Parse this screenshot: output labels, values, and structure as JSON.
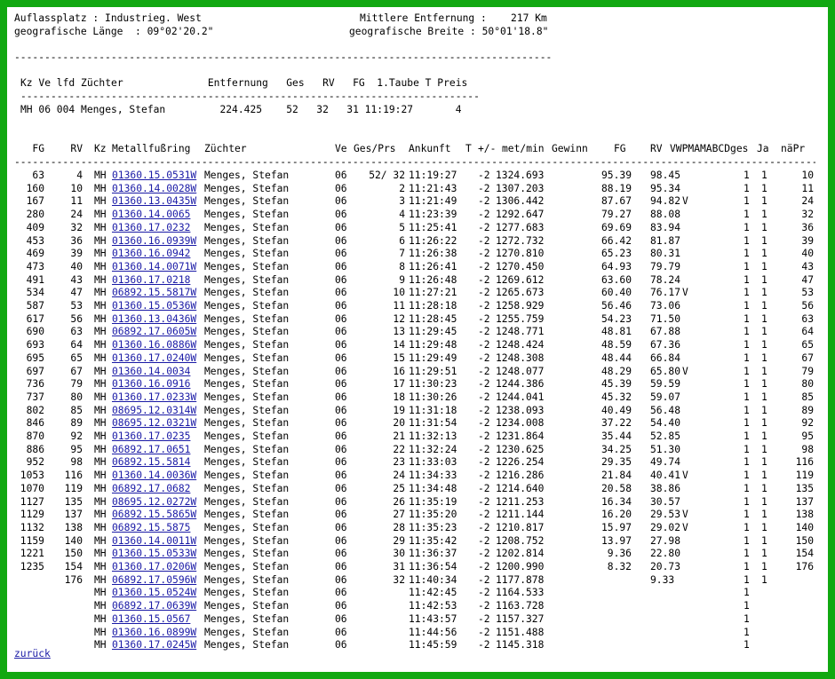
{
  "header": {
    "left1": "Auflassplatz : Industrieg. West",
    "right1": "Mittlere Entfernung :    217 Km",
    "left2": "geografische Länge  : 09°02'20.2\"",
    "right2": "geografische Breite : 50°01'18.8\"",
    "rule_long": "--------------------------------------------------------------------------------------------------------"
  },
  "summary": {
    "headers": "Kz Ve lfd Züchter              Entfernung   Ges   RV   FG  1.Taube T Preis",
    "rule": "--------------------------------------------------------------------------------------------",
    "row": "MH 06 004 Menges, Stefan         224.425    52   32   31 11:19:27       4"
  },
  "table": {
    "columns": {
      "fg": "FG",
      "rv": "RV",
      "kz": "Kz",
      "ring": "Metallfußring",
      "name": "Züchter",
      "ve": "Ve",
      "gespr": "Ges/Prs",
      "ankunft": "Ankunft",
      "t": "T",
      "pm": "+/-",
      "speed": "met/min",
      "gewinn": "Gewinn",
      "fg2": "FG",
      "rv2": "RV",
      "flags": "VWPMAMABCDges",
      "ja": "Ja",
      "napr": "näPr"
    },
    "rule": "----------------------------------------------------------------------------------------------------------------------------------------------------------",
    "rows": [
      {
        "fg": "63",
        "rv": "4",
        "kz": "MH",
        "ring": "01360.15.0531W",
        "name": "Menges, Stefan",
        "ve": "06",
        "pos": "52/ 32",
        "ankunft": "11:19:27",
        "pm": "-2",
        "speed": "1324.693",
        "fg2": "95.39",
        "rv2": "98.45",
        "v": "",
        "c1": "1",
        "c2": "1",
        "napr": "10"
      },
      {
        "fg": "160",
        "rv": "10",
        "kz": "MH",
        "ring": "01360.14.0028W",
        "name": "Menges, Stefan",
        "ve": "06",
        "pos": "2",
        "ankunft": "11:21:43",
        "pm": "-2",
        "speed": "1307.203",
        "fg2": "88.19",
        "rv2": "95.34",
        "v": "",
        "c1": "1",
        "c2": "1",
        "napr": "11"
      },
      {
        "fg": "167",
        "rv": "11",
        "kz": "MH",
        "ring": "01360.13.0435W",
        "name": "Menges, Stefan",
        "ve": "06",
        "pos": "3",
        "ankunft": "11:21:49",
        "pm": "-2",
        "speed": "1306.442",
        "fg2": "87.67",
        "rv2": "94.82",
        "v": "V",
        "c1": "1",
        "c2": "1",
        "napr": "24"
      },
      {
        "fg": "280",
        "rv": "24",
        "kz": "MH",
        "ring": "01360.14.0065",
        "name": "Menges, Stefan",
        "ve": "06",
        "pos": "4",
        "ankunft": "11:23:39",
        "pm": "-2",
        "speed": "1292.647",
        "fg2": "79.27",
        "rv2": "88.08",
        "v": "",
        "c1": "1",
        "c2": "1",
        "napr": "32"
      },
      {
        "fg": "409",
        "rv": "32",
        "kz": "MH",
        "ring": "01360.17.0232",
        "name": "Menges, Stefan",
        "ve": "06",
        "pos": "5",
        "ankunft": "11:25:41",
        "pm": "-2",
        "speed": "1277.683",
        "fg2": "69.69",
        "rv2": "83.94",
        "v": "",
        "c1": "1",
        "c2": "1",
        "napr": "36"
      },
      {
        "fg": "453",
        "rv": "36",
        "kz": "MH",
        "ring": "01360.16.0939W",
        "name": "Menges, Stefan",
        "ve": "06",
        "pos": "6",
        "ankunft": "11:26:22",
        "pm": "-2",
        "speed": "1272.732",
        "fg2": "66.42",
        "rv2": "81.87",
        "v": "",
        "c1": "1",
        "c2": "1",
        "napr": "39"
      },
      {
        "fg": "469",
        "rv": "39",
        "kz": "MH",
        "ring": "01360.16.0942",
        "name": "Menges, Stefan",
        "ve": "06",
        "pos": "7",
        "ankunft": "11:26:38",
        "pm": "-2",
        "speed": "1270.810",
        "fg2": "65.23",
        "rv2": "80.31",
        "v": "",
        "c1": "1",
        "c2": "1",
        "napr": "40"
      },
      {
        "fg": "473",
        "rv": "40",
        "kz": "MH",
        "ring": "01360.14.0071W",
        "name": "Menges, Stefan",
        "ve": "06",
        "pos": "8",
        "ankunft": "11:26:41",
        "pm": "-2",
        "speed": "1270.450",
        "fg2": "64.93",
        "rv2": "79.79",
        "v": "",
        "c1": "1",
        "c2": "1",
        "napr": "43"
      },
      {
        "fg": "491",
        "rv": "43",
        "kz": "MH",
        "ring": "01360.17.0218",
        "name": "Menges, Stefan",
        "ve": "06",
        "pos": "9",
        "ankunft": "11:26:48",
        "pm": "-2",
        "speed": "1269.612",
        "fg2": "63.60",
        "rv2": "78.24",
        "v": "",
        "c1": "1",
        "c2": "1",
        "napr": "47"
      },
      {
        "fg": "534",
        "rv": "47",
        "kz": "MH",
        "ring": "06892.15.5817W",
        "name": "Menges, Stefan",
        "ve": "06",
        "pos": "10",
        "ankunft": "11:27:21",
        "pm": "-2",
        "speed": "1265.673",
        "fg2": "60.40",
        "rv2": "76.17",
        "v": "V",
        "c1": "1",
        "c2": "1",
        "napr": "53"
      },
      {
        "fg": "587",
        "rv": "53",
        "kz": "MH",
        "ring": "01360.15.0536W",
        "name": "Menges, Stefan",
        "ve": "06",
        "pos": "11",
        "ankunft": "11:28:18",
        "pm": "-2",
        "speed": "1258.929",
        "fg2": "56.46",
        "rv2": "73.06",
        "v": "",
        "c1": "1",
        "c2": "1",
        "napr": "56"
      },
      {
        "fg": "617",
        "rv": "56",
        "kz": "MH",
        "ring": "01360.13.0436W",
        "name": "Menges, Stefan",
        "ve": "06",
        "pos": "12",
        "ankunft": "11:28:45",
        "pm": "-2",
        "speed": "1255.759",
        "fg2": "54.23",
        "rv2": "71.50",
        "v": "",
        "c1": "1",
        "c2": "1",
        "napr": "63"
      },
      {
        "fg": "690",
        "rv": "63",
        "kz": "MH",
        "ring": "06892.17.0605W",
        "name": "Menges, Stefan",
        "ve": "06",
        "pos": "13",
        "ankunft": "11:29:45",
        "pm": "-2",
        "speed": "1248.771",
        "fg2": "48.81",
        "rv2": "67.88",
        "v": "",
        "c1": "1",
        "c2": "1",
        "napr": "64"
      },
      {
        "fg": "693",
        "rv": "64",
        "kz": "MH",
        "ring": "01360.16.0886W",
        "name": "Menges, Stefan",
        "ve": "06",
        "pos": "14",
        "ankunft": "11:29:48",
        "pm": "-2",
        "speed": "1248.424",
        "fg2": "48.59",
        "rv2": "67.36",
        "v": "",
        "c1": "1",
        "c2": "1",
        "napr": "65"
      },
      {
        "fg": "695",
        "rv": "65",
        "kz": "MH",
        "ring": "01360.17.0240W",
        "name": "Menges, Stefan",
        "ve": "06",
        "pos": "15",
        "ankunft": "11:29:49",
        "pm": "-2",
        "speed": "1248.308",
        "fg2": "48.44",
        "rv2": "66.84",
        "v": "",
        "c1": "1",
        "c2": "1",
        "napr": "67"
      },
      {
        "fg": "697",
        "rv": "67",
        "kz": "MH",
        "ring": "01360.14.0034",
        "name": "Menges, Stefan",
        "ve": "06",
        "pos": "16",
        "ankunft": "11:29:51",
        "pm": "-2",
        "speed": "1248.077",
        "fg2": "48.29",
        "rv2": "65.80",
        "v": "V",
        "c1": "1",
        "c2": "1",
        "napr": "79"
      },
      {
        "fg": "736",
        "rv": "79",
        "kz": "MH",
        "ring": "01360.16.0916",
        "name": "Menges, Stefan",
        "ve": "06",
        "pos": "17",
        "ankunft": "11:30:23",
        "pm": "-2",
        "speed": "1244.386",
        "fg2": "45.39",
        "rv2": "59.59",
        "v": "",
        "c1": "1",
        "c2": "1",
        "napr": "80"
      },
      {
        "fg": "737",
        "rv": "80",
        "kz": "MH",
        "ring": "01360.17.0233W",
        "name": "Menges, Stefan",
        "ve": "06",
        "pos": "18",
        "ankunft": "11:30:26",
        "pm": "-2",
        "speed": "1244.041",
        "fg2": "45.32",
        "rv2": "59.07",
        "v": "",
        "c1": "1",
        "c2": "1",
        "napr": "85"
      },
      {
        "fg": "802",
        "rv": "85",
        "kz": "MH",
        "ring": "08695.12.0314W",
        "name": "Menges, Stefan",
        "ve": "06",
        "pos": "19",
        "ankunft": "11:31:18",
        "pm": "-2",
        "speed": "1238.093",
        "fg2": "40.49",
        "rv2": "56.48",
        "v": "",
        "c1": "1",
        "c2": "1",
        "napr": "89"
      },
      {
        "fg": "846",
        "rv": "89",
        "kz": "MH",
        "ring": "08695.12.0321W",
        "name": "Menges, Stefan",
        "ve": "06",
        "pos": "20",
        "ankunft": "11:31:54",
        "pm": "-2",
        "speed": "1234.008",
        "fg2": "37.22",
        "rv2": "54.40",
        "v": "",
        "c1": "1",
        "c2": "1",
        "napr": "92"
      },
      {
        "fg": "870",
        "rv": "92",
        "kz": "MH",
        "ring": "01360.17.0235",
        "name": "Menges, Stefan",
        "ve": "06",
        "pos": "21",
        "ankunft": "11:32:13",
        "pm": "-2",
        "speed": "1231.864",
        "fg2": "35.44",
        "rv2": "52.85",
        "v": "",
        "c1": "1",
        "c2": "1",
        "napr": "95"
      },
      {
        "fg": "886",
        "rv": "95",
        "kz": "MH",
        "ring": "06892.17.0651",
        "name": "Menges, Stefan",
        "ve": "06",
        "pos": "22",
        "ankunft": "11:32:24",
        "pm": "-2",
        "speed": "1230.625",
        "fg2": "34.25",
        "rv2": "51.30",
        "v": "",
        "c1": "1",
        "c2": "1",
        "napr": "98"
      },
      {
        "fg": "952",
        "rv": "98",
        "kz": "MH",
        "ring": "06892.15.5814",
        "name": "Menges, Stefan",
        "ve": "06",
        "pos": "23",
        "ankunft": "11:33:03",
        "pm": "-2",
        "speed": "1226.254",
        "fg2": "29.35",
        "rv2": "49.74",
        "v": "",
        "c1": "1",
        "c2": "1",
        "napr": "116"
      },
      {
        "fg": "1053",
        "rv": "116",
        "kz": "MH",
        "ring": "01360.14.0036W",
        "name": "Menges, Stefan",
        "ve": "06",
        "pos": "24",
        "ankunft": "11:34:33",
        "pm": "-2",
        "speed": "1216.286",
        "fg2": "21.84",
        "rv2": "40.41",
        "v": "V",
        "c1": "1",
        "c2": "1",
        "napr": "119"
      },
      {
        "fg": "1070",
        "rv": "119",
        "kz": "MH",
        "ring": "06892.17.0682",
        "name": "Menges, Stefan",
        "ve": "06",
        "pos": "25",
        "ankunft": "11:34:48",
        "pm": "-2",
        "speed": "1214.640",
        "fg2": "20.58",
        "rv2": "38.86",
        "v": "",
        "c1": "1",
        "c2": "1",
        "napr": "135"
      },
      {
        "fg": "1127",
        "rv": "135",
        "kz": "MH",
        "ring": "08695.12.0272W",
        "name": "Menges, Stefan",
        "ve": "06",
        "pos": "26",
        "ankunft": "11:35:19",
        "pm": "-2",
        "speed": "1211.253",
        "fg2": "16.34",
        "rv2": "30.57",
        "v": "",
        "c1": "1",
        "c2": "1",
        "napr": "137"
      },
      {
        "fg": "1129",
        "rv": "137",
        "kz": "MH",
        "ring": "06892.15.5865W",
        "name": "Menges, Stefan",
        "ve": "06",
        "pos": "27",
        "ankunft": "11:35:20",
        "pm": "-2",
        "speed": "1211.144",
        "fg2": "16.20",
        "rv2": "29.53",
        "v": "V",
        "c1": "1",
        "c2": "1",
        "napr": "138"
      },
      {
        "fg": "1132",
        "rv": "138",
        "kz": "MH",
        "ring": "06892.15.5875",
        "name": "Menges, Stefan",
        "ve": "06",
        "pos": "28",
        "ankunft": "11:35:23",
        "pm": "-2",
        "speed": "1210.817",
        "fg2": "15.97",
        "rv2": "29.02",
        "v": "V",
        "c1": "1",
        "c2": "1",
        "napr": "140"
      },
      {
        "fg": "1159",
        "rv": "140",
        "kz": "MH",
        "ring": "01360.14.0011W",
        "name": "Menges, Stefan",
        "ve": "06",
        "pos": "29",
        "ankunft": "11:35:42",
        "pm": "-2",
        "speed": "1208.752",
        "fg2": "13.97",
        "rv2": "27.98",
        "v": "",
        "c1": "1",
        "c2": "1",
        "napr": "150"
      },
      {
        "fg": "1221",
        "rv": "150",
        "kz": "MH",
        "ring": "01360.15.0533W",
        "name": "Menges, Stefan",
        "ve": "06",
        "pos": "30",
        "ankunft": "11:36:37",
        "pm": "-2",
        "speed": "1202.814",
        "fg2": "9.36",
        "rv2": "22.80",
        "v": "",
        "c1": "1",
        "c2": "1",
        "napr": "154"
      },
      {
        "fg": "1235",
        "rv": "154",
        "kz": "MH",
        "ring": "01360.17.0206W",
        "name": "Menges, Stefan",
        "ve": "06",
        "pos": "31",
        "ankunft": "11:36:54",
        "pm": "-2",
        "speed": "1200.990",
        "fg2": "8.32",
        "rv2": "20.73",
        "v": "",
        "c1": "1",
        "c2": "1",
        "napr": "176"
      },
      {
        "fg": "",
        "rv": "176",
        "kz": "MH",
        "ring": "06892.17.0596W",
        "name": "Menges, Stefan",
        "ve": "06",
        "pos": "32",
        "ankunft": "11:40:34",
        "pm": "-2",
        "speed": "1177.878",
        "fg2": "",
        "rv2": "9.33",
        "v": "",
        "c1": "1",
        "c2": "1",
        "napr": ""
      },
      {
        "fg": "",
        "rv": "",
        "kz": "MH",
        "ring": "01360.15.0524W",
        "name": "Menges, Stefan",
        "ve": "06",
        "pos": "",
        "ankunft": "11:42:45",
        "pm": "-2",
        "speed": "1164.533",
        "fg2": "",
        "rv2": "",
        "v": "",
        "c1": "1",
        "c2": "",
        "napr": ""
      },
      {
        "fg": "",
        "rv": "",
        "kz": "MH",
        "ring": "06892.17.0639W",
        "name": "Menges, Stefan",
        "ve": "06",
        "pos": "",
        "ankunft": "11:42:53",
        "pm": "-2",
        "speed": "1163.728",
        "fg2": "",
        "rv2": "",
        "v": "",
        "c1": "1",
        "c2": "",
        "napr": ""
      },
      {
        "fg": "",
        "rv": "",
        "kz": "MH",
        "ring": "01360.15.0567",
        "name": "Menges, Stefan",
        "ve": "06",
        "pos": "",
        "ankunft": "11:43:57",
        "pm": "-2",
        "speed": "1157.327",
        "fg2": "",
        "rv2": "",
        "v": "",
        "c1": "1",
        "c2": "",
        "napr": ""
      },
      {
        "fg": "",
        "rv": "",
        "kz": "MH",
        "ring": "01360.16.0899W",
        "name": "Menges, Stefan",
        "ve": "06",
        "pos": "",
        "ankunft": "11:44:56",
        "pm": "-2",
        "speed": "1151.488",
        "fg2": "",
        "rv2": "",
        "v": "",
        "c1": "1",
        "c2": "",
        "napr": ""
      },
      {
        "fg": "",
        "rv": "",
        "kz": "MH",
        "ring": "01360.17.0245W",
        "name": "Menges, Stefan",
        "ve": "06",
        "pos": "",
        "ankunft": "11:45:59",
        "pm": "-2",
        "speed": "1145.318",
        "fg2": "",
        "rv2": "",
        "v": "",
        "c1": "1",
        "c2": "",
        "napr": ""
      }
    ]
  },
  "footer": {
    "back_link": "zurück"
  },
  "colors": {
    "border": "#11a811",
    "link": "#1a1aa6"
  }
}
